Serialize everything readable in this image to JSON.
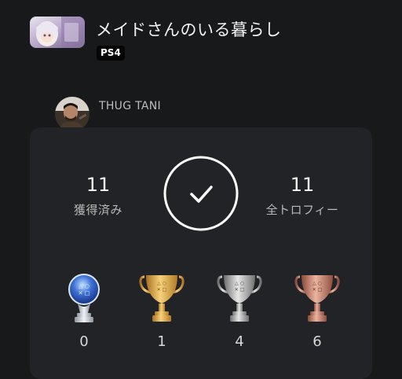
{
  "game": {
    "title": "メイドさんのいる暮らし",
    "platform": "PS4",
    "thumbnail_icon": "game-cover-thumbnail"
  },
  "user": {
    "name": "THUG TANI",
    "avatar_icon": "user-avatar"
  },
  "summary": {
    "earned_value": "11",
    "earned_label": "獲得済み",
    "total_value": "11",
    "total_label": "全トロフィー",
    "complete_icon": "checkmark-circle-icon"
  },
  "trophies": [
    {
      "type": "platinum",
      "icon": "platinum-trophy-icon",
      "count": "0"
    },
    {
      "type": "gold",
      "icon": "gold-trophy-icon",
      "count": "1"
    },
    {
      "type": "silver",
      "icon": "silver-trophy-icon",
      "count": "4"
    },
    {
      "type": "bronze",
      "icon": "bronze-trophy-icon",
      "count": "6"
    }
  ],
  "colors": {
    "background": "#18191b",
    "panel": "#222326",
    "platinum": "#6f8fd6",
    "gold": "#d8a441",
    "silver": "#a9a9a9",
    "bronze": "#c77f6a"
  }
}
